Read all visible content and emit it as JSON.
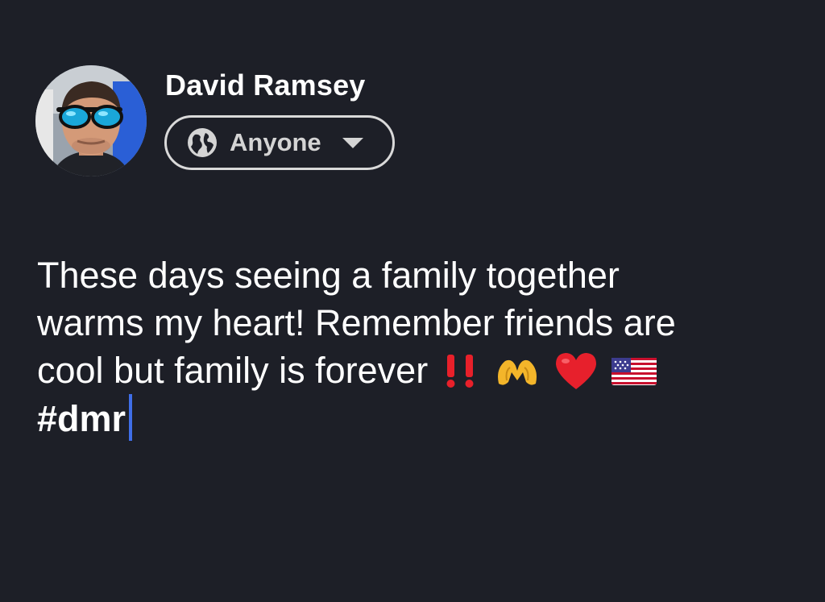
{
  "author": {
    "name": "David Ramsey",
    "avatar_icon": "profile-photo"
  },
  "audience": {
    "label": "Anyone",
    "icon": "globe-icon",
    "dropdown_icon": "caret-down-icon"
  },
  "post": {
    "lines": [
      "These days seeing a family together",
      "warms my heart! Remember friends are",
      "cool but family is forever"
    ],
    "emojis": [
      "double-exclamation",
      "heart-hands",
      "red-heart",
      "us-flag"
    ],
    "hashtag": "#dmr"
  },
  "colors": {
    "background": "#1d1f27",
    "text": "#ffffff",
    "cursor": "#3f6ee8",
    "pill_border": "#d9d9d9"
  }
}
